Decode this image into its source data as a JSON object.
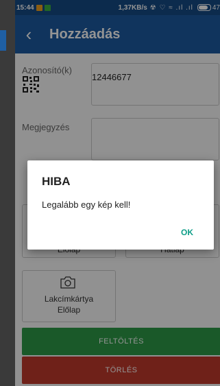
{
  "status_bar": {
    "time": "15:44",
    "net_rate": "1,37KB/s",
    "system_icons": "☢ ♡ ≈ .ıl .ıl",
    "battery": "47"
  },
  "toolbar": {
    "back_icon": "‹",
    "title": "Hozzáadás",
    "color": "#1c5aa0"
  },
  "form": {
    "id_label": "Azonosító(k)",
    "id_value": "12446677",
    "note_label": "Megjegyzés",
    "note_value": ""
  },
  "photos": {
    "front_label": "Előlap",
    "back_label": "Hátlap",
    "address_card_label": "Lakcímkártya",
    "address_card_sub": "Előlap"
  },
  "actions": {
    "upload_label": "FELTÖLTÉS",
    "upload_color": "#2e9a48",
    "delete_label": "TÖRLÉS",
    "delete_color": "#c0392b"
  },
  "dialog": {
    "title": "HIBA",
    "message": "Legalább egy kép kell!",
    "ok_label": "OK"
  }
}
